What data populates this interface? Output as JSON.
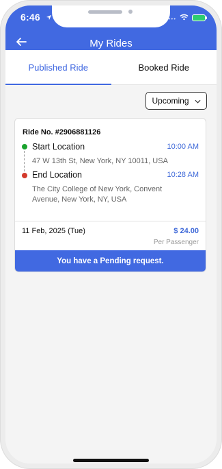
{
  "status_bar": {
    "time": "6:46"
  },
  "app_bar": {
    "title": "My Rides"
  },
  "tabs": [
    {
      "label": "Published Ride",
      "active": true
    },
    {
      "label": "Booked Ride",
      "active": false
    }
  ],
  "filter": {
    "selected": "Upcoming"
  },
  "ride": {
    "ride_no": "Ride No. #2906881126",
    "start": {
      "title": "Start Location",
      "time": "10:00 AM",
      "address": "47 W 13th St, New York, NY 10011, USA"
    },
    "end": {
      "title": "End Location",
      "time": "10:28 AM",
      "address": "The City College of New York, Convent Avenue, New York, NY, USA"
    },
    "date": "11 Feb, 2025 (Tue)",
    "price": "$ 24.00",
    "price_unit": "Per Passenger",
    "pending_text": "You have a Pending request."
  },
  "colors": {
    "primary": "#4169e1",
    "start_dot": "#1aa32e",
    "end_dot": "#d33a2c",
    "link_blue": "#3c67d8"
  }
}
